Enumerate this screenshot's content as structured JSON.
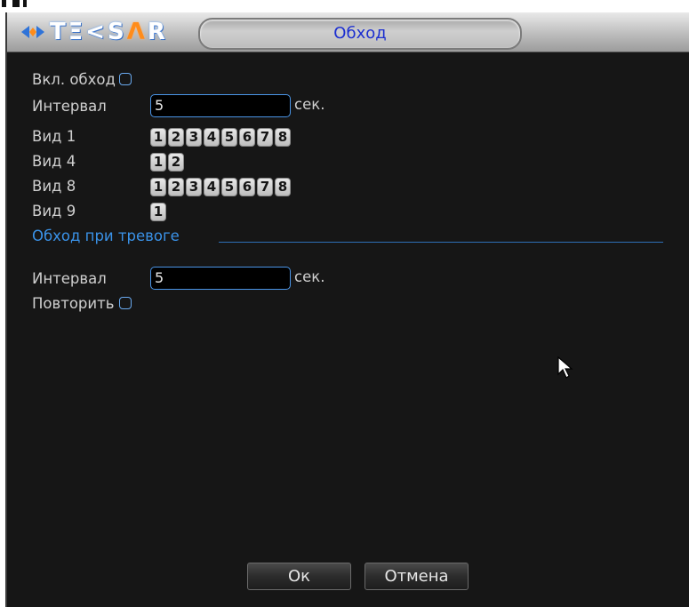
{
  "window": {
    "logo": "TEKSAR",
    "title": "Обход"
  },
  "tour": {
    "enable_label": "Вкл. обход",
    "interval_label": "Интервал",
    "interval_value": "5",
    "interval_unit": "сек.",
    "views": [
      {
        "label": "Вид 1",
        "channels": [
          "1",
          "2",
          "3",
          "4",
          "5",
          "6",
          "7",
          "8"
        ]
      },
      {
        "label": "Вид 4",
        "channels": [
          "1",
          "2"
        ]
      },
      {
        "label": "Вид 8",
        "channels": [
          "1",
          "2",
          "3",
          "4",
          "5",
          "6",
          "7",
          "8"
        ]
      },
      {
        "label": "Вид 9",
        "channels": [
          "1"
        ]
      }
    ]
  },
  "alarm": {
    "section_title": "Обход при тревоге",
    "interval_label": "Интервал",
    "interval_value": "5",
    "interval_unit": "сек.",
    "repeat_label": "Повторить"
  },
  "buttons": {
    "ok": "Ок",
    "cancel": "Отмена"
  },
  "colors": {
    "window_bg": "#161616",
    "accent_blue": "#3a92e8",
    "title_text": "#1c2fd0"
  }
}
